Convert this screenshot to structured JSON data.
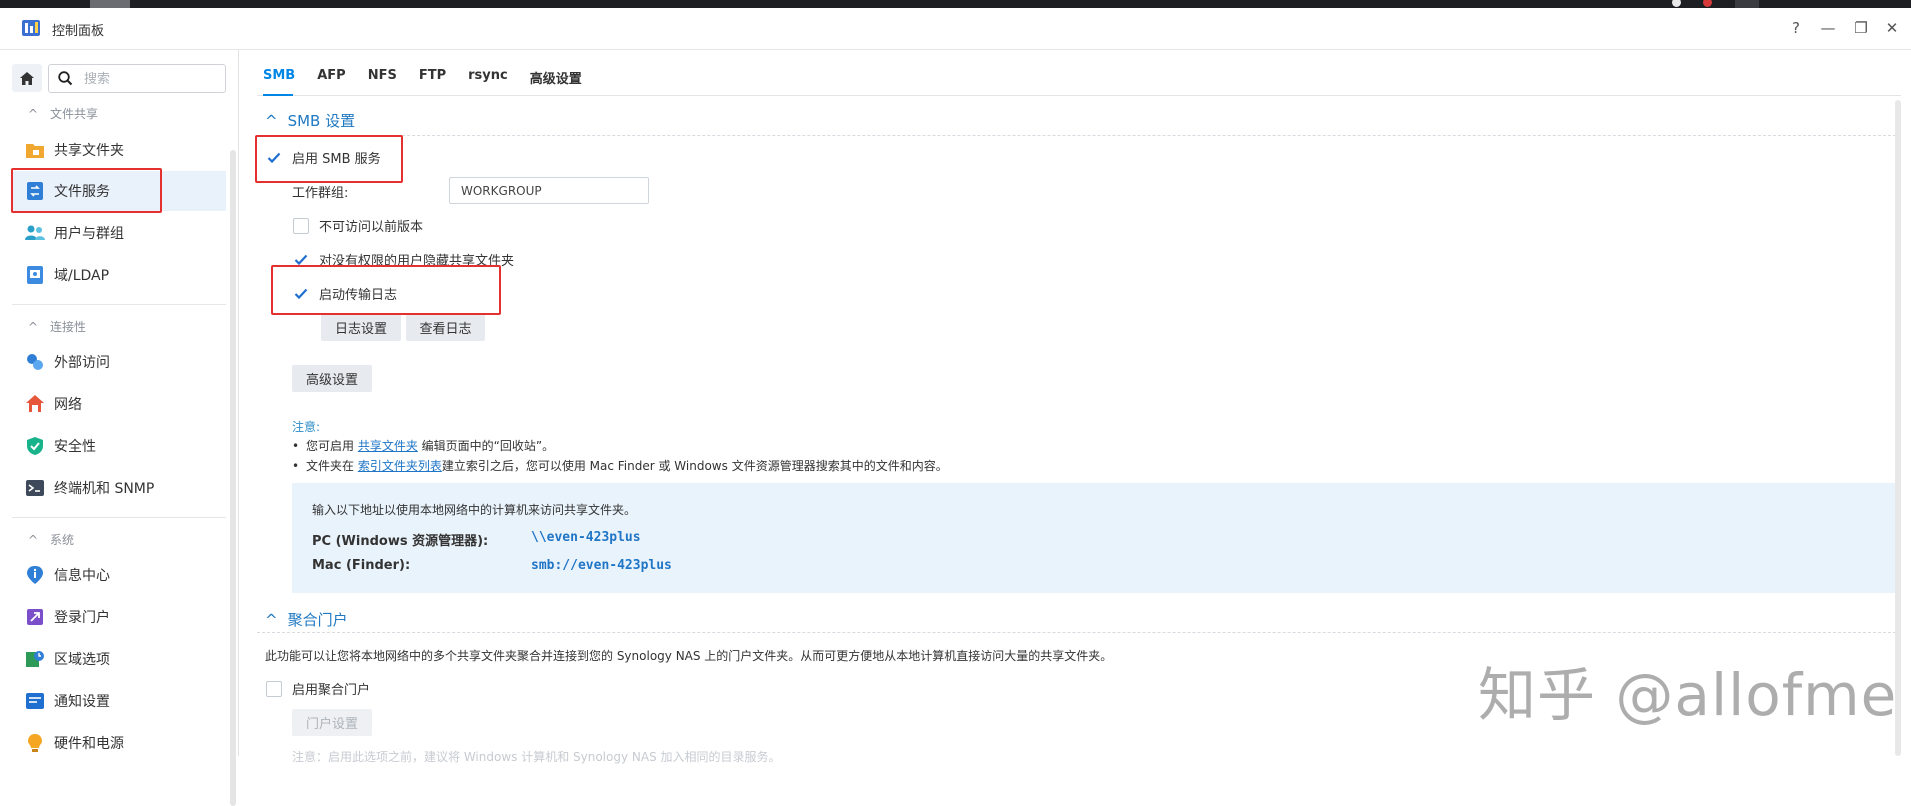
{
  "window": {
    "title": "控制面板",
    "help_glyph": "?",
    "minimize_glyph": "—",
    "restore_glyph": "❐",
    "close_glyph": "✕"
  },
  "sidebar": {
    "search_placeholder": "搜索",
    "sections": [
      {
        "label": "文件共享",
        "items": [
          {
            "label": "共享文件夹",
            "icon": "shared-folder-icon"
          },
          {
            "label": "文件服务",
            "icon": "file-services-icon",
            "active": true
          },
          {
            "label": "用户与群组",
            "icon": "users-icon"
          },
          {
            "label": "域/LDAP",
            "icon": "domain-ldap-icon"
          }
        ]
      },
      {
        "label": "连接性",
        "items": [
          {
            "label": "外部访问",
            "icon": "external-access-icon"
          },
          {
            "label": "网络",
            "icon": "network-icon"
          },
          {
            "label": "安全性",
            "icon": "security-shield-icon"
          },
          {
            "label": "终端机和 SNMP",
            "icon": "terminal-icon"
          }
        ]
      },
      {
        "label": "系统",
        "items": [
          {
            "label": "信息中心",
            "icon": "info-center-icon"
          },
          {
            "label": "登录门户",
            "icon": "login-portal-icon"
          },
          {
            "label": "区域选项",
            "icon": "regional-options-icon"
          },
          {
            "label": "通知设置",
            "icon": "notification-icon"
          },
          {
            "label": "硬件和电源",
            "icon": "hardware-power-icon"
          }
        ]
      }
    ]
  },
  "tabs": [
    "SMB",
    "AFP",
    "NFS",
    "FTP",
    "rsync",
    "高级设置"
  ],
  "smb": {
    "section_title": "SMB 设置",
    "enable_label": "启用 SMB 服务",
    "workgroup_label": "工作群组:",
    "workgroup_value": "WORKGROUP",
    "prev_versions_label": "不可访问以前版本",
    "hide_folders_label": "对没有权限的用户隐藏共享文件夹",
    "transfer_log_label": "启动传输日志",
    "log_settings_btn": "日志设置",
    "view_log_btn": "查看日志",
    "advanced_btn": "高级设置",
    "note_title": "注意:",
    "note1_pre": "您可启用 ",
    "note1_link": "共享文件夹",
    "note1_post": " 编辑页面中的“回收站”。",
    "note2_pre": "文件夹在 ",
    "note2_link": "索引文件夹列表",
    "note2_post": "建立索引之后，您可以使用 Mac Finder 或 Windows 文件资源管理器搜索其中的文件和内容。",
    "info_intro": "输入以下地址以使用本地网络中的计算机来访问共享文件夹。",
    "pc_label": "PC (Windows 资源管理器):",
    "pc_value": "\\\\even-423plus",
    "mac_label": "Mac (Finder):",
    "mac_value": "smb://even-423plus"
  },
  "portal": {
    "section_title": "聚合门户",
    "description": "此功能可以让您将本地网络中的多个共享文件夹聚合并连接到您的 Synology NAS 上的门户文件夹。从而可更方便地从本地计算机直接访问大量的共享文件夹。",
    "enable_label": "启用聚合门户",
    "portal_settings_btn": "门户设置",
    "cutoff_note": "注意：启用此选项之前，建议将 Windows 计算机和 Synology NAS 加入相同的目录服务。"
  },
  "watermark": "知乎 @allofme",
  "colors": {
    "accent": "#0086e5",
    "link": "#1f75c6",
    "highlight_box": "#e53030",
    "info_bg": "#e9f3fb",
    "active_item_bg": "#e9f1fb"
  }
}
